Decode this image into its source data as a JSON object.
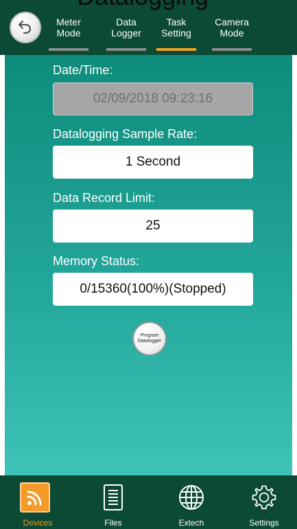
{
  "header": {
    "partial_title": "Datalogging",
    "tabs": [
      {
        "label": "Meter\nMode",
        "active": false
      },
      {
        "label": "Data\nLogger",
        "active": false
      },
      {
        "label": "Task\nSetting",
        "active": true
      },
      {
        "label": "Camera\nMode",
        "active": false
      }
    ]
  },
  "form": {
    "date_time_label": "Date/Time:",
    "date_time_value": "02/09/2018 09:23:16",
    "sample_rate_label": "Datalogging Sample Rate:",
    "sample_rate_value": "1 Second",
    "record_limit_label": "Data Record Limit:",
    "record_limit_value": "25",
    "memory_label": "Memory Status:",
    "memory_value": "0/15360(100%)(Stopped)",
    "program_button_label": "Program\nDatalogger"
  },
  "bottom_nav": {
    "items": [
      {
        "label": "Devices",
        "icon": "rss-icon",
        "active": true
      },
      {
        "label": "Files",
        "icon": "file-icon",
        "active": false
      },
      {
        "label": "Extech",
        "icon": "globe-icon",
        "active": false
      },
      {
        "label": "Settings",
        "icon": "gear-icon",
        "active": false
      }
    ]
  },
  "colors": {
    "header_bg": "#0c4a36",
    "active_accent": "#f2a22a",
    "content_gradient_top": "#0e8b7b",
    "content_gradient_bottom": "#3fc2b8"
  }
}
